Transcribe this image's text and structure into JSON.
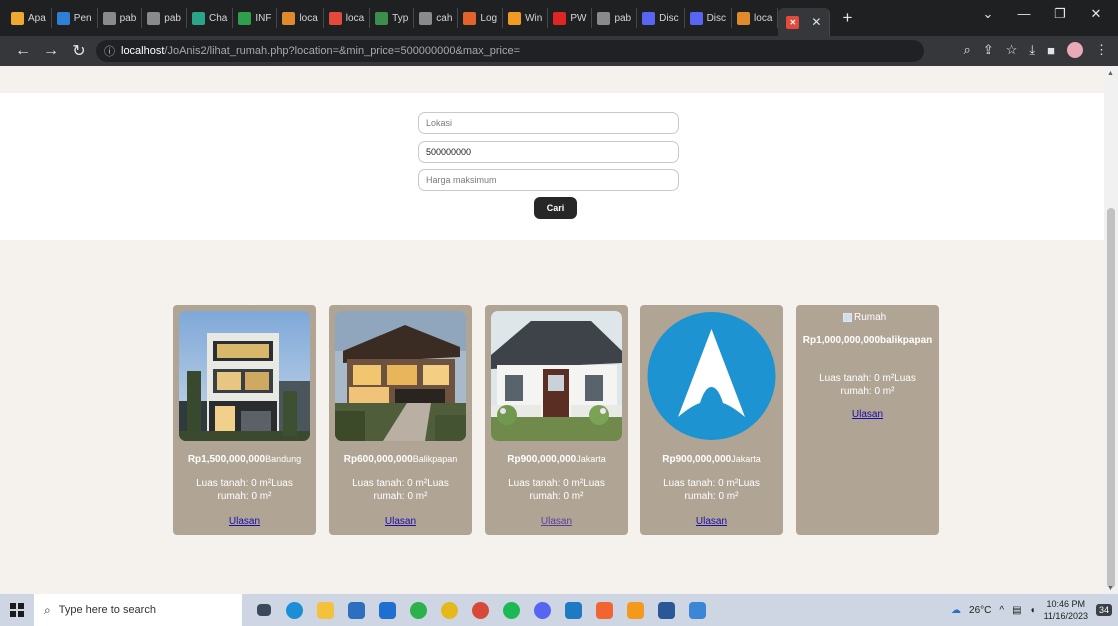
{
  "browser": {
    "tabs": [
      {
        "title": "Apa",
        "color": "#f0a830",
        "glyph": ""
      },
      {
        "title": "Pen",
        "color": "#2f7fd6",
        "glyph": ""
      },
      {
        "title": "pab",
        "color": "#8a8a8a",
        "glyph": ""
      },
      {
        "title": "pab",
        "color": "#8a8a8a",
        "glyph": ""
      },
      {
        "title": "Cha",
        "color": "#2aa58a",
        "glyph": ""
      },
      {
        "title": "INF",
        "color": "#2f9f4b",
        "glyph": ""
      },
      {
        "title": "loca",
        "color": "#e08b2b",
        "glyph": ""
      },
      {
        "title": "loca",
        "color": "#e34a3b",
        "glyph": ""
      },
      {
        "title": "Typ",
        "color": "#3c8f4b",
        "glyph": ""
      },
      {
        "title": "cah",
        "color": "#8a8a8a",
        "glyph": ""
      },
      {
        "title": "Log",
        "color": "#e2642b",
        "glyph": ""
      },
      {
        "title": "Win",
        "color": "#f29b22",
        "glyph": ""
      },
      {
        "title": "PW",
        "color": "#e02525",
        "glyph": ""
      },
      {
        "title": "pab",
        "color": "#8a8a8a",
        "glyph": ""
      },
      {
        "title": "Disc",
        "color": "#5865f2",
        "glyph": ""
      },
      {
        "title": "Disc",
        "color": "#5865f2",
        "glyph": ""
      },
      {
        "title": "loca",
        "color": "#e08b2b",
        "glyph": ""
      }
    ],
    "active_tab_color": "#e34a3b",
    "url_host": "localhost",
    "url_path": "/JoAnis2/lihat_rumah.php?location=&min_price=500000000&max_price="
  },
  "search": {
    "location_placeholder": "Lokasi",
    "min_price_value": "500000000",
    "max_price_placeholder": "Harga maksimum",
    "button_label": "Cari"
  },
  "listings": [
    {
      "price": "Rp1,500,000,000",
      "city": "Bandung",
      "area": "Luas tanah: 0 m²Luas rumah: 0 m²",
      "link": "Ulasan",
      "photo": "modern-townhouse"
    },
    {
      "price": "Rp600,000,000",
      "city": "Balikpapan",
      "area": "Luas tanah: 0 m²Luas rumah: 0 m²",
      "link": "Ulasan",
      "photo": "timber-villa"
    },
    {
      "price": "Rp900,000,000",
      "city": "Jakarta",
      "area": "Luas tanah: 0 m²Luas rumah: 0 m²",
      "link": "Ulasan",
      "photo": "white-cottage"
    },
    {
      "price": "Rp900,000,000",
      "city": "Jakarta",
      "area": "Luas tanah: 0 m²Luas rumah: 0 m²",
      "link": "Ulasan",
      "photo": "arch-linux-logo"
    },
    {
      "alt": "Rumah",
      "price_city": "Rp1,000,000,000balikpapan",
      "area": "Luas tanah: 0 m²Luas rumah: 0 m²",
      "link": "Ulasan"
    }
  ],
  "taskbar": {
    "search_placeholder": "Type here to search",
    "temperature": "26°C",
    "time": "10:46 PM",
    "date": "11/16/2023",
    "notifications": "34"
  }
}
